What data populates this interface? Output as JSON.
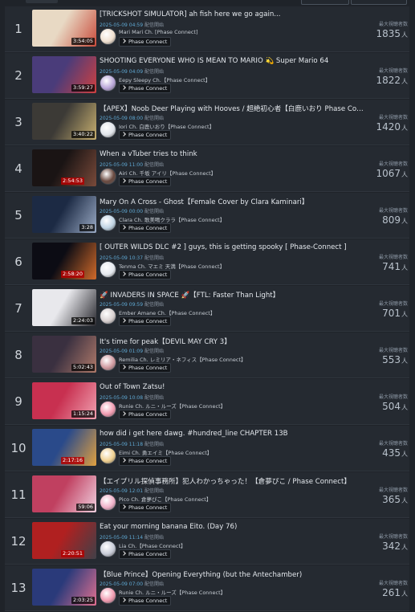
{
  "viewers_label": "最大視聴者数",
  "start_label": "配信開始",
  "badge_label": "Phase Connect",
  "unit": "人",
  "streams": [
    {
      "rank": "1",
      "title": "[TRICKSHOT SIMULATOR] ah fish here we go again...",
      "date": "2025-05-09 04:59",
      "channel": "Mari Mari Ch. [Phase Connect]",
      "viewers": "1835",
      "duration": "3:54:05",
      "thumb_colors": [
        "#e8d9c4",
        "#c94c3c"
      ],
      "avatar_color": "#f0e0d0"
    },
    {
      "rank": "2",
      "title": "SHOOTING EVERYONE WHO IS MEAN TO MARIO 💫 Super Mario 64",
      "date": "2025-05-09 04:09",
      "channel": "Eepy Sleepy Ch.【Phase Connect】",
      "viewers": "1822",
      "duration": "3:59:27",
      "thumb_colors": [
        "#4a3c7a",
        "#d04040"
      ],
      "avatar_color": "#b9a6d8"
    },
    {
      "rank": "3",
      "title": "【APEX】Noob Deer Playing with Hooves / 超絶初心者【白鹿いおり Phase Connect】",
      "date": "2025-05-09 08:00",
      "channel": "Iori Ch. 白鹿いおり【Phase Connect】",
      "viewers": "1420",
      "duration": "3:40:22",
      "thumb_colors": [
        "#3c3a36",
        "#c8b070"
      ],
      "avatar_color": "#e0e4ea"
    },
    {
      "rank": "4",
      "title": "When a vTuber tries to think",
      "date": "2025-05-09 11:00",
      "channel": "Airi Ch. 千坂 アイリ【Phase Connect】",
      "viewers": "1067",
      "duration": "2:54:53",
      "thumb_colors": [
        "#1a1414",
        "#7a4a3a"
      ],
      "avatar_color": "#6a4a40"
    },
    {
      "rank": "5",
      "title": "Mary On A Cross - Ghost【Female Cover by Clara Kaminari】",
      "date": "2025-05-09 00:00",
      "channel": "Clara Ch. 歌美鳴クララ【Phase Connect】",
      "viewers": "809",
      "duration": "3:28",
      "thumb_colors": [
        "#1c2a44",
        "#9aaac4"
      ],
      "avatar_color": "#c0d4e4"
    },
    {
      "rank": "6",
      "title": "[ OUTER WILDS DLC #2 ] guys, this is getting spooky [ Phase-Connect ]",
      "date": "2025-05-09 10:37",
      "channel": "Tenma Ch. マエミ 天満【Phase Connect】",
      "viewers": "741",
      "duration": "2:58:20",
      "thumb_colors": [
        "#0c0c14",
        "#d06a2a"
      ],
      "avatar_color": "#e4e8ee"
    },
    {
      "rank": "7",
      "title": "🚀 INVADERS IN SPACE 🚀【FTL: Faster Than Light】",
      "date": "2025-05-09 09:59",
      "channel": "Ember Amane Ch.【Phase Connect】",
      "viewers": "701",
      "duration": "2:24:03",
      "thumb_colors": [
        "#e8e8ec",
        "#2a2a30"
      ],
      "avatar_color": "#d8d0d0"
    },
    {
      "rank": "8",
      "title": "It's time for peak【DEVIL MAY CRY 3】",
      "date": "2025-05-09 01:09",
      "channel": "Remilia Ch. レミリア・ネフィス【Phase Connect】",
      "viewers": "553",
      "duration": "5:02:43",
      "thumb_colors": [
        "#3a3040",
        "#b07a6a"
      ],
      "avatar_color": "#d09aa0"
    },
    {
      "rank": "9",
      "title": "Out of Town Zatsu!",
      "date": "2025-05-09 10:08",
      "channel": "Runie Ch. ルニ・ルーズ【Phase Connect】",
      "viewers": "504",
      "duration": "1:15:24",
      "thumb_colors": [
        "#c83050",
        "#f0a0b0"
      ],
      "avatar_color": "#f09ab0"
    },
    {
      "rank": "10",
      "title": "how did i get here dawg. #hundred_line CHAPTER 13B",
      "date": "2025-05-09 11:18",
      "channel": "Eimi Ch. 勇エイミ【Phase Connect】",
      "viewers": "435",
      "duration": "2:17:16",
      "thumb_colors": [
        "#2a4a8a",
        "#e0a040"
      ],
      "avatar_color": "#f0d090"
    },
    {
      "rank": "11",
      "title": "【エイプリル探偵事務所】犯人わかっちゃった！【倉夢ぴこ / Phase Connect】",
      "date": "2025-05-09 12:01",
      "channel": "Pico Ch. 倉夢ぴこ【Phase Connect】",
      "viewers": "365",
      "duration": "59:06",
      "thumb_colors": [
        "#c04060",
        "#f0d0e0"
      ],
      "avatar_color": "#f0b0c8"
    },
    {
      "rank": "12",
      "title": "Eat your morning banana Eito. (Day 76)",
      "date": "2025-05-09 11:14",
      "channel": "Lia Ch.【Phase Connect】",
      "viewers": "342",
      "duration": "2:20:51",
      "thumb_colors": [
        "#b02020",
        "#404048"
      ],
      "avatar_color": "#c8ccd8"
    },
    {
      "rank": "13",
      "title": "【Blue Prince】Opening Everything (but the Antechamber)",
      "date": "2025-05-09 07:00",
      "channel": "Runie Ch. ルニ・ルーズ【Phase Connect】",
      "viewers": "261",
      "duration": "2:03:25",
      "thumb_colors": [
        "#2a3a7a",
        "#e07090"
      ],
      "avatar_color": "#f09ab0"
    }
  ]
}
